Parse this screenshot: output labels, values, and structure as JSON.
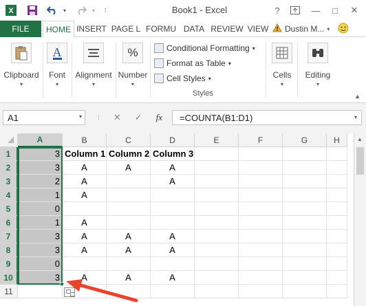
{
  "titlebar": {
    "title": "Book1 - Excel",
    "help": "?",
    "restore_ribbon": "↑",
    "minimize": "—",
    "maximize": "□",
    "close": "✕"
  },
  "tabs": {
    "file": "FILE",
    "items": [
      "HOME",
      "INSERT",
      "PAGE L",
      "FORMU",
      "DATA",
      "REVIEW",
      "VIEW"
    ],
    "active_index": 0,
    "user": "Dustin M...",
    "accent": "#217346"
  },
  "ribbon": {
    "clipboard": "Clipboard",
    "font": "Font",
    "alignment": "Alignment",
    "number": "Number",
    "number_symbol": "%",
    "font_symbol": "A",
    "conditional_formatting": "Conditional Formatting",
    "format_as_table": "Format as Table",
    "cell_styles": "Cell Styles",
    "styles": "Styles",
    "cells": "Cells",
    "editing": "Editing"
  },
  "formula_bar": {
    "name_box": "A1",
    "cancel": "✕",
    "enter": "✓",
    "fx": "fx",
    "formula": "=COUNTA(B1:D1)"
  },
  "grid": {
    "columns": [
      "A",
      "B",
      "C",
      "D",
      "E",
      "F",
      "G",
      "H"
    ],
    "selected_column": "A",
    "rows": [
      {
        "num": "1",
        "a": "3",
        "b": "Column 1",
        "c": "Column 2",
        "d": "Column 3"
      },
      {
        "num": "2",
        "a": "3",
        "b": "A",
        "c": "A",
        "d": "A"
      },
      {
        "num": "3",
        "a": "2",
        "b": "A",
        "c": "",
        "d": "A"
      },
      {
        "num": "4",
        "a": "1",
        "b": "A",
        "c": "",
        "d": ""
      },
      {
        "num": "5",
        "a": "0",
        "b": "",
        "c": "",
        "d": ""
      },
      {
        "num": "6",
        "a": "1",
        "b": "A",
        "c": "",
        "d": ""
      },
      {
        "num": "7",
        "a": "3",
        "b": "A",
        "c": "A",
        "d": "A"
      },
      {
        "num": "8",
        "a": "3",
        "b": "A",
        "c": "A",
        "d": "A"
      },
      {
        "num": "9",
        "a": "0",
        "b": "",
        "c": "",
        "d": ""
      },
      {
        "num": "10",
        "a": "3",
        "b": "A",
        "c": "A",
        "d": "A"
      },
      {
        "num": "11",
        "a": "",
        "b": "",
        "c": "",
        "d": ""
      }
    ]
  },
  "annotation": {
    "arrow_color": "#e8442c"
  }
}
